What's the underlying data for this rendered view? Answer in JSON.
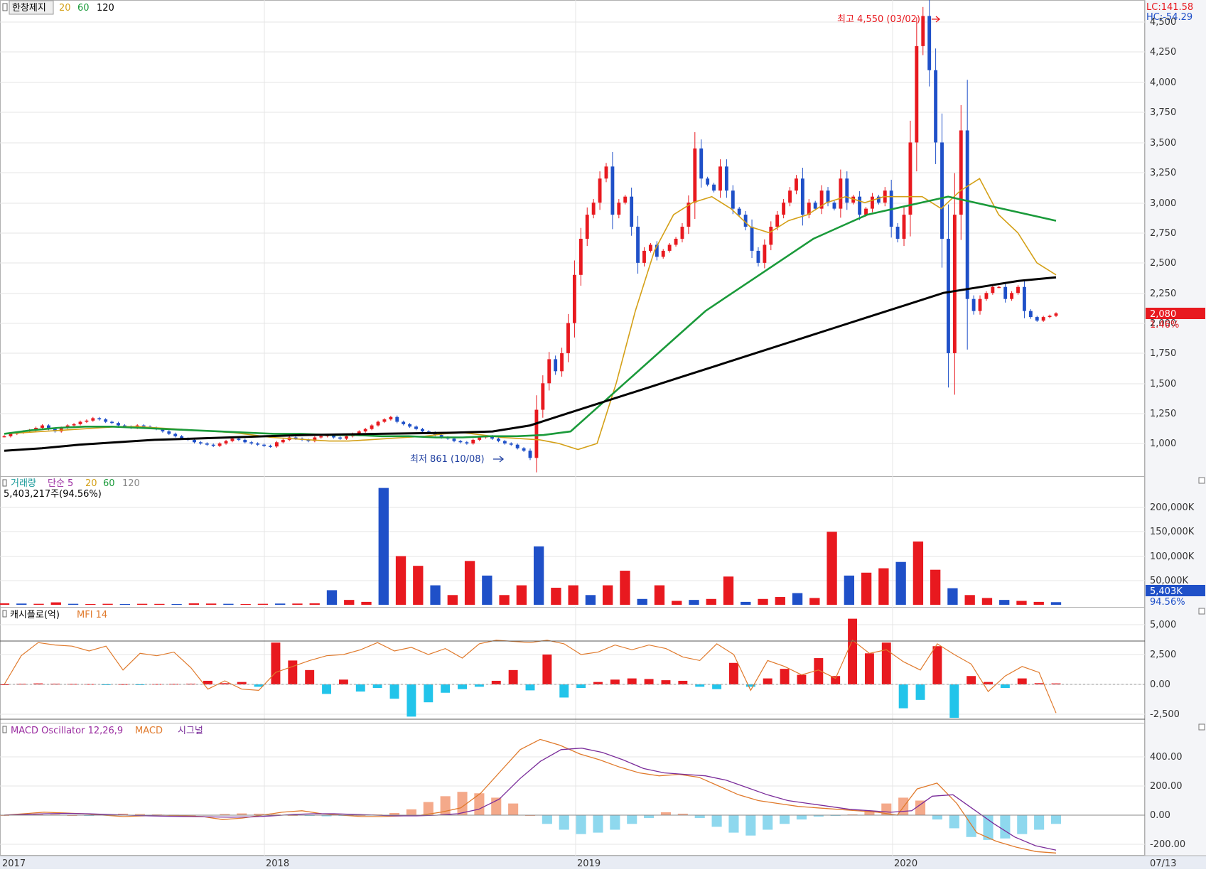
{
  "main": {
    "ticker": "한창제지",
    "ma_labels": [
      {
        "text": "20",
        "color": "#d4a017"
      },
      {
        "text": "60",
        "color": "#1a9a3a"
      },
      {
        "text": "120",
        "color": "#000000"
      }
    ],
    "lc": "LC:141.58",
    "hc": "HC:-54.29",
    "price_tag": "2,080",
    "change_tag": "1.46%",
    "high_note": "최고 4,550 (03/02)",
    "low_note": "최저 861 (10/08)",
    "y_ticks": [
      "1,000",
      "1,250",
      "1,500",
      "1,750",
      "2,000",
      "2,250",
      "2,500",
      "2,750",
      "3,000",
      "3,250",
      "3,500",
      "3,750",
      "4,000",
      "4,250",
      "4,500"
    ]
  },
  "volume": {
    "label": "거래량",
    "sma_label": "단순 5",
    "ma_labels": [
      {
        "text": "20",
        "color": "#d4a017"
      },
      {
        "text": "60",
        "color": "#1a9a3a"
      },
      {
        "text": "120",
        "color": "#888888"
      }
    ],
    "current": "5,403,217주(94.56%)",
    "tag": "5,403K",
    "pct_tag": "94.56%",
    "y_ticks": [
      "50,000K",
      "100,000K",
      "150,000K",
      "200,000K"
    ]
  },
  "flow": {
    "label": "캐시플로(억)",
    "mfi_label": "MFI 14",
    "y_ticks": [
      "-2,500",
      "0.00",
      "2,500",
      "5,000"
    ]
  },
  "macd": {
    "label": "MACD Oscillator 12,26,9",
    "macd_label": "MACD",
    "signal_label": "시그널",
    "y_ticks": [
      "-200.00",
      "0.00",
      "200.00",
      "400.00"
    ]
  },
  "x_axis": {
    "labels": [
      "2017",
      "2018",
      "2019",
      "2020"
    ],
    "date_tag": "07/13"
  },
  "colors": {
    "up": "#e8191f",
    "down": "#1f50c8",
    "ma20": "#d4a017",
    "ma60": "#1a9a3a",
    "ma120": "#000000",
    "osc_pos": "#f4a98a",
    "osc_neg": "#8ed8ee",
    "flow_pos": "#e8191f",
    "flow_neg": "#22c4ea",
    "macd": "#e07a2c",
    "signal": "#7a2c9a"
  },
  "chart_data": [
    {
      "type": "candlestick",
      "title": "한창제지",
      "interval": "weekly",
      "x_range": [
        "2017-01",
        "2020-07-13"
      ],
      "ylim": [
        800,
        4600
      ],
      "annotations": [
        "최고 4,550 (03/02)",
        "최저 861 (10/08)"
      ],
      "series": [
        {
          "name": "price",
          "values": [
            1060,
            1080,
            1090,
            1100,
            1110,
            1130,
            1150,
            1120,
            1100,
            1130,
            1150,
            1160,
            1180,
            1190,
            1210,
            1200,
            1180,
            1170,
            1150,
            1140,
            1130,
            1150,
            1140,
            1130,
            1120,
            1100,
            1080,
            1060,
            1040,
            1030,
            1010,
            1000,
            990,
            980,
            1000,
            1020,
            1040,
            1030,
            1010,
            1000,
            990,
            980,
            975,
            1010,
            1030,
            1050,
            1040,
            1030,
            1020,
            1050,
            1060,
            1070,
            1050,
            1040,
            1060,
            1080,
            1100,
            1120,
            1150,
            1180,
            1200,
            1220,
            1180,
            1160,
            1140,
            1120,
            1100,
            1090,
            1070,
            1050,
            1040,
            1020,
            1010,
            1000,
            1030,
            1050,
            1060,
            1040,
            1020,
            1000,
            990,
            960,
            940,
            880,
            1280,
            1500,
            1700,
            1600,
            1750,
            2000,
            2400,
            2700,
            2900,
            3000,
            3200,
            3300,
            2900,
            3000,
            3050,
            2800,
            2500,
            2600,
            2650,
            2550,
            2600,
            2650,
            2700,
            2800,
            3000,
            3450,
            3200,
            3150,
            3100,
            3300,
            3100,
            2950,
            2900,
            2800,
            2600,
            2500,
            2650,
            2800,
            2900,
            3000,
            3100,
            3200,
            2900,
            3000,
            2950,
            3100,
            3000,
            2950,
            3200,
            3000,
            3050,
            2900,
            2950,
            3050,
            3000,
            3100,
            2800,
            2700,
            2900,
            3500,
            4300,
            4550,
            4100,
            3500,
            2700,
            1750,
            2900,
            3600,
            2200,
            2100,
            2200,
            2250,
            2300,
            2300,
            2200,
            2250,
            2300,
            2100,
            2050,
            2020,
            2050,
            2060,
            2080
          ]
        },
        {
          "name": "20",
          "values": [
            1080,
            1090,
            1100,
            1110,
            1120,
            1130,
            1140,
            1140,
            1130,
            1120,
            1110,
            1100,
            1090,
            1070,
            1050,
            1040,
            1030,
            1020,
            1020,
            1030,
            1040,
            1050,
            1060,
            1080,
            1090,
            1070,
            1050,
            1040,
            1030,
            1000,
            950,
            1000,
            1500,
            2100,
            2600,
            2900,
            3000,
            3050,
            2950,
            2800,
            2750,
            2850,
            2900,
            3000,
            3050,
            3000,
            3050,
            3050,
            3050,
            2950,
            3100,
            3200,
            2900,
            2750,
            2500,
            2400
          ]
        },
        {
          "name": "60",
          "values": [
            1080,
            1110,
            1130,
            1140,
            1140,
            1130,
            1120,
            1110,
            1100,
            1090,
            1080,
            1080,
            1070,
            1070,
            1060,
            1060,
            1050,
            1050,
            1060,
            1060,
            1070,
            1100,
            1300,
            1500,
            1700,
            1900,
            2100,
            2250,
            2400,
            2550,
            2700,
            2800,
            2900,
            2950,
            3000,
            3050,
            3000,
            2950,
            2900,
            2850
          ]
        },
        {
          "name": "120",
          "values": [
            940,
            960,
            990,
            1010,
            1030,
            1040,
            1050,
            1060,
            1070,
            1075,
            1080,
            1085,
            1090,
            1100,
            1150,
            1250,
            1350,
            1450,
            1550,
            1650,
            1750,
            1850,
            1950,
            2050,
            2150,
            2250,
            2300,
            2350,
            2380
          ]
        }
      ]
    },
    {
      "type": "bar",
      "title": "거래량",
      "unit": "K shares",
      "ylim": [
        0,
        250000
      ],
      "current_value": 5403217,
      "series": [
        {
          "name": "volume",
          "values": [
            3000,
            2500,
            2000,
            5000,
            2000,
            1500,
            2000,
            1500,
            2000,
            1800,
            1500,
            3000,
            2500,
            2000,
            1500,
            2000,
            2500,
            2500,
            3000,
            30000,
            10000,
            6000,
            240000,
            100000,
            80000,
            40000,
            20000,
            90000,
            60000,
            20000,
            40000,
            120000,
            35000,
            40000,
            20000,
            40000,
            70000,
            12000,
            40000,
            8000,
            10000,
            12000,
            58000,
            6000,
            12000,
            16000,
            24000,
            14000,
            150000,
            60000,
            66000,
            75000,
            88000,
            130000,
            72000,
            34000,
            20000,
            14000,
            10000,
            8000,
            6000,
            5403
          ]
        }
      ]
    },
    {
      "type": "bar",
      "title": "캐시플로(억)",
      "ylim": [
        -3000,
        5500
      ],
      "series": [
        {
          "name": "cashflow",
          "values": [
            0,
            50,
            80,
            60,
            40,
            30,
            -20,
            20,
            -10,
            30,
            40,
            60,
            300,
            100,
            200,
            -200,
            3500,
            2000,
            1200,
            -800,
            400,
            -600,
            -300,
            -1200,
            -2700,
            -1500,
            -700,
            -400,
            -200,
            300,
            1200,
            -500,
            2500,
            -1100,
            -300,
            200,
            400,
            500,
            450,
            350,
            300,
            -200,
            -400,
            1800,
            -200,
            500,
            1300,
            800,
            2200,
            700,
            5500,
            2600,
            3500,
            -2000,
            -1300,
            3200,
            -2800,
            700,
            200,
            -300,
            500,
            100,
            80
          ]
        },
        {
          "name": "MFI 14",
          "values": [
            0,
            2400,
            3500,
            3300,
            3200,
            2800,
            3200,
            1200,
            2600,
            2400,
            2700,
            1400,
            -400,
            300,
            -400,
            -500,
            1000,
            1500,
            2000,
            2400,
            2500,
            2900,
            3500,
            2800,
            3100,
            2500,
            3000,
            2200,
            3400,
            3700,
            3600,
            3500,
            3700,
            3400,
            2500,
            2700,
            3300,
            2900,
            3300,
            3000,
            2300,
            2000,
            3400,
            2500,
            -500,
            2000,
            1500,
            800,
            1200,
            500,
            3700,
            2600,
            2900,
            1900,
            1200,
            3400,
            2500,
            1700,
            -600,
            700,
            1500,
            1000,
            -2400
          ]
        }
      ]
    },
    {
      "type": "bar",
      "title": "MACD Oscillator 12,26,9",
      "ylim": [
        -260,
        520
      ],
      "series": [
        {
          "name": "MACD Oscillator 12,26,9",
          "values": [
            0,
            5,
            10,
            5,
            0,
            -2,
            5,
            10,
            8,
            5,
            3,
            0,
            2,
            8,
            12,
            10,
            5,
            0,
            -3,
            -8,
            -5,
            0,
            5,
            15,
            40,
            90,
            130,
            160,
            150,
            120,
            80,
            0,
            -60,
            -100,
            -130,
            -120,
            -100,
            -60,
            -20,
            20,
            10,
            -20,
            -80,
            -120,
            -140,
            -100,
            -60,
            -30,
            -10,
            -5,
            5,
            30,
            80,
            120,
            100,
            -30,
            -90,
            -150,
            -170,
            -160,
            -130,
            -100,
            -60
          ]
        },
        {
          "name": "MACD",
          "values": [
            0,
            10,
            20,
            15,
            10,
            0,
            -10,
            -5,
            0,
            -5,
            -10,
            -30,
            -20,
            0,
            20,
            30,
            10,
            0,
            -10,
            -10,
            -5,
            0,
            20,
            50,
            150,
            300,
            450,
            520,
            480,
            420,
            380,
            330,
            290,
            270,
            280,
            260,
            200,
            140,
            100,
            80,
            60,
            50,
            40,
            30,
            20,
            0,
            180,
            220,
            80,
            -120,
            -180,
            -220,
            -250,
            -260
          ]
        },
        {
          "name": "시그널",
          "values": [
            0,
            5,
            10,
            12,
            10,
            5,
            0,
            -5,
            -8,
            -10,
            -12,
            -14,
            -12,
            -5,
            5,
            10,
            10,
            5,
            0,
            -5,
            -5,
            0,
            10,
            40,
            110,
            250,
            370,
            450,
            460,
            430,
            380,
            320,
            290,
            280,
            270,
            240,
            190,
            140,
            100,
            80,
            60,
            40,
            30,
            20,
            30,
            130,
            140,
            40,
            -60,
            -150,
            -210,
            -240
          ]
        }
      ]
    }
  ]
}
